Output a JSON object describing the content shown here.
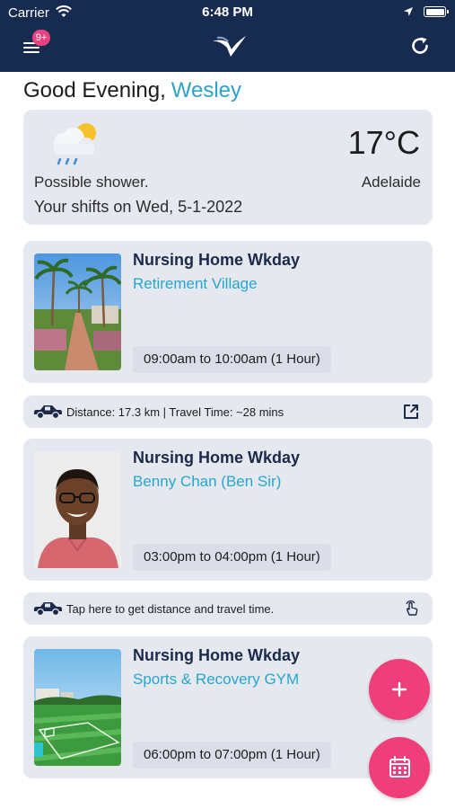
{
  "status_bar": {
    "carrier": "Carrier",
    "time": "6:48 PM"
  },
  "nav": {
    "menu_icon": "hamburger-menu-icon",
    "badge": "9+",
    "logo_icon": "brand-logo-icon",
    "refresh_icon": "refresh-icon"
  },
  "greeting": {
    "text": "Good Evening,",
    "name": "Wesley"
  },
  "weather": {
    "icon": "sun-cloud-rain-icon",
    "temperature": "17°C",
    "condition": "Possible shower.",
    "city": "Adelaide",
    "shifts_date": "Your shifts on Wed, 5-1-2022"
  },
  "shifts": [
    {
      "title": "Nursing Home Wkday",
      "subtitle": "Retirement Village",
      "time": "09:00am to 10:00am (1 Hour)",
      "image": "palm-tree-village-photo"
    },
    {
      "title": "Nursing Home Wkday",
      "subtitle": "Benny Chan (Ben Sir)",
      "time": "03:00pm to 04:00pm (1 Hour)",
      "image": "client-portrait-photo"
    },
    {
      "title": "Nursing Home Wkday",
      "subtitle": "Sports & Recovery GYM",
      "time": "06:00pm to 07:00pm (1 Hour)",
      "image": "sports-field-photo"
    }
  ],
  "travel": [
    {
      "text": "Distance: 17.3 km | Travel Time: ~28 mins",
      "icon": "car-icon",
      "action_icon": "external-link-icon"
    },
    {
      "text": "Tap here to get distance and travel time.",
      "icon": "car-icon",
      "action_icon": "tap-hand-icon"
    }
  ],
  "fabs": {
    "add_icon": "plus-icon",
    "calendar_icon": "calendar-icon"
  },
  "colors": {
    "navbar": "#172a4f",
    "accent": "#25a6cf",
    "fab": "#ee3f7b",
    "card": "#e6e8ef",
    "badge": "#e8437f"
  }
}
